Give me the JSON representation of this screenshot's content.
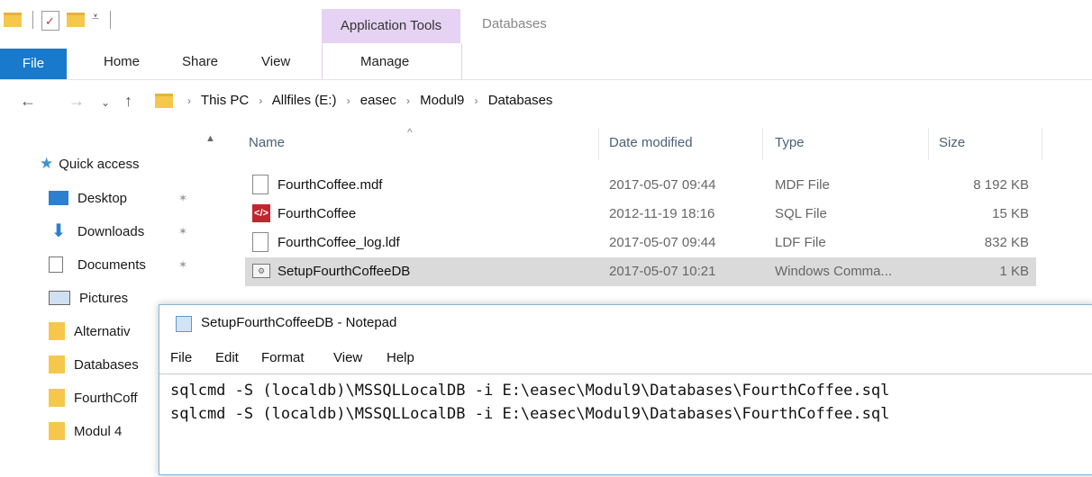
{
  "ribbon": {
    "context_group": "Application Tools",
    "location_title": "Databases",
    "tabs": [
      "File",
      "Home",
      "Share",
      "View",
      "Manage"
    ]
  },
  "breadcrumb": [
    "This PC",
    "Allfiles (E:)",
    "easec",
    "Modul9",
    "Databases"
  ],
  "nav_pane": {
    "quick_access": "Quick access",
    "items": [
      {
        "label": "Desktop",
        "icon": "desktop-icon",
        "pinned": true
      },
      {
        "label": "Downloads",
        "icon": "download-icon",
        "pinned": true
      },
      {
        "label": "Documents",
        "icon": "documents-icon",
        "pinned": true
      },
      {
        "label": "Pictures",
        "icon": "pictures-icon",
        "pinned": true
      },
      {
        "label": "Alternativ",
        "icon": "folder-icon",
        "pinned": false
      },
      {
        "label": "Databases",
        "icon": "folder-icon",
        "pinned": false
      },
      {
        "label": "FourthCoff",
        "icon": "folder-icon",
        "pinned": false
      },
      {
        "label": "Modul 4",
        "icon": "folder-icon",
        "pinned": false
      }
    ]
  },
  "file_list": {
    "columns": [
      "Name",
      "Date modified",
      "Type",
      "Size"
    ],
    "rows": [
      {
        "name": "FourthCoffee.mdf",
        "date": "2017-05-07 09:44",
        "type": "MDF File",
        "size": "8 192 KB",
        "icon": "file-icon",
        "selected": false
      },
      {
        "name": "FourthCoffee",
        "date": "2012-11-19 18:16",
        "type": "SQL File",
        "size": "15 KB",
        "icon": "sql-file-icon",
        "selected": false
      },
      {
        "name": "FourthCoffee_log.ldf",
        "date": "2017-05-07 09:44",
        "type": "LDF File",
        "size": "832 KB",
        "icon": "file-icon",
        "selected": false
      },
      {
        "name": "SetupFourthCoffeeDB",
        "date": "2017-05-07 10:21",
        "type": "Windows Comma...",
        "size": "1 KB",
        "icon": "cmd-file-icon",
        "selected": true
      }
    ]
  },
  "notepad": {
    "title": "SetupFourthCoffeeDB - Notepad",
    "menu": [
      "File",
      "Edit",
      "Format",
      "View",
      "Help"
    ],
    "lines": [
      "sqlcmd -S (localdb)\\MSSQLLocalDB -i E:\\easec\\Modul9\\Databases\\FourthCoffee.sql",
      "sqlcmd -S (localdb)\\MSSQLLocalDB -i E:\\easec\\Modul9\\Databases\\FourthCoffee.sql"
    ]
  },
  "colors": {
    "accent": "#1979ca",
    "context_tab": "#e6d2f2",
    "selection": "#dadada",
    "folder": "#f5c84c"
  }
}
